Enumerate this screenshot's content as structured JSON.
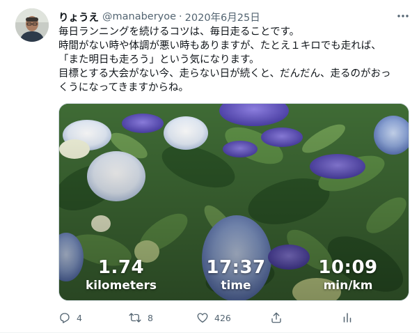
{
  "tweet": {
    "display_name": "りょうえ",
    "handle": "@manaberyoe",
    "separator": "·",
    "date": "2020年6月25日",
    "text_lines": [
      "毎日ランニングを続けるコツは、毎日走ることです。",
      "時間がない時や体調が悪い時もありますが、たとえ１キロでも走れば、",
      "「また明日も走ろう」という気になります。",
      "目標とする大会がない今、走らない日が続くと、だんだん、走るのがおっ",
      "くうになってきますからね。"
    ],
    "media": {
      "description_icon": "hydrangea-photo",
      "distance_value": "1.74",
      "distance_unit": "kilometers",
      "time_value": "17:37",
      "time_unit": "time",
      "pace_value": "10:09",
      "pace_unit": "min/km"
    },
    "actions": {
      "reply_count": "4",
      "retweet_count": "8",
      "like_count": "426"
    },
    "icons": {
      "more": "more-horizontal-icon",
      "reply": "reply-icon",
      "retweet": "retweet-icon",
      "like": "heart-icon",
      "share": "share-icon",
      "analytics": "analytics-icon"
    },
    "colors": {
      "text_primary": "#0f1419",
      "text_secondary": "#536471",
      "border": "#cfd9de"
    }
  }
}
